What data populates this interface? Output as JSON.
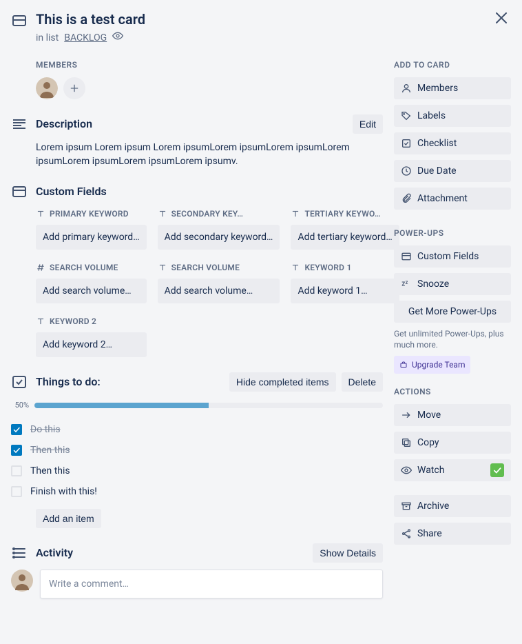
{
  "header": {
    "title": "This is a test card",
    "in_list_prefix": "in list",
    "list_name": "BACKLOG"
  },
  "members": {
    "heading": "MEMBERS"
  },
  "description": {
    "title": "Description",
    "edit_label": "Edit",
    "body": "Lorem ipsum Lorem ipsum Lorem ipsumLorem ipsumLorem ipsumLorem ipsumLorem ipsumLorem ipsumLorem ipsumv."
  },
  "custom_fields": {
    "title": "Custom Fields",
    "items": [
      {
        "type": "text",
        "label": "PRIMARY KEYWORD",
        "placeholder": "Add primary keyword…"
      },
      {
        "type": "text",
        "label": "SECONDARY KEYWORD",
        "label_display": "SECONDARY KEY…",
        "placeholder": "Add secondary keyword…"
      },
      {
        "type": "text",
        "label": "TERTIARY KEYWORD",
        "label_display": "TERTIARY KEYWO…",
        "placeholder": "Add tertiary keyword…"
      },
      {
        "type": "number",
        "label": "SEARCH VOLUME",
        "placeholder": "Add search volume…"
      },
      {
        "type": "text",
        "label": "SEARCH VOLUME",
        "placeholder": "Add search volume…"
      },
      {
        "type": "text",
        "label": "KEYWORD 1",
        "placeholder": "Add keyword 1…"
      },
      {
        "type": "text",
        "label": "KEYWORD 2",
        "placeholder": "Add keyword 2…"
      }
    ]
  },
  "checklist": {
    "title": "Things to do:",
    "hide_label": "Hide completed items",
    "delete_label": "Delete",
    "progress_pct": "50%",
    "progress_value": 50,
    "items": [
      {
        "text": "Do this",
        "done": true
      },
      {
        "text": "Then this",
        "done": true
      },
      {
        "text": "Then this",
        "done": false
      },
      {
        "text": "Finish with this!",
        "done": false
      }
    ],
    "add_item_label": "Add an item"
  },
  "activity": {
    "title": "Activity",
    "show_details_label": "Show Details",
    "comment_placeholder": "Write a comment…"
  },
  "sidebar": {
    "add_heading": "ADD TO CARD",
    "add": {
      "members": "Members",
      "labels": "Labels",
      "checklist": "Checklist",
      "due_date": "Due Date",
      "attachment": "Attachment"
    },
    "powerups_heading": "POWER-UPS",
    "powerups": {
      "custom_fields": "Custom Fields",
      "snooze": "Snooze",
      "get_more": "Get More Power-Ups",
      "note": "Get unlimited Power-Ups, plus much more.",
      "upgrade": "Upgrade Team"
    },
    "actions_heading": "ACTIONS",
    "actions": {
      "move": "Move",
      "copy": "Copy",
      "watch": "Watch",
      "archive": "Archive",
      "share": "Share"
    }
  },
  "colors": {
    "blue": "#0079bf",
    "green": "#61bd4f"
  }
}
